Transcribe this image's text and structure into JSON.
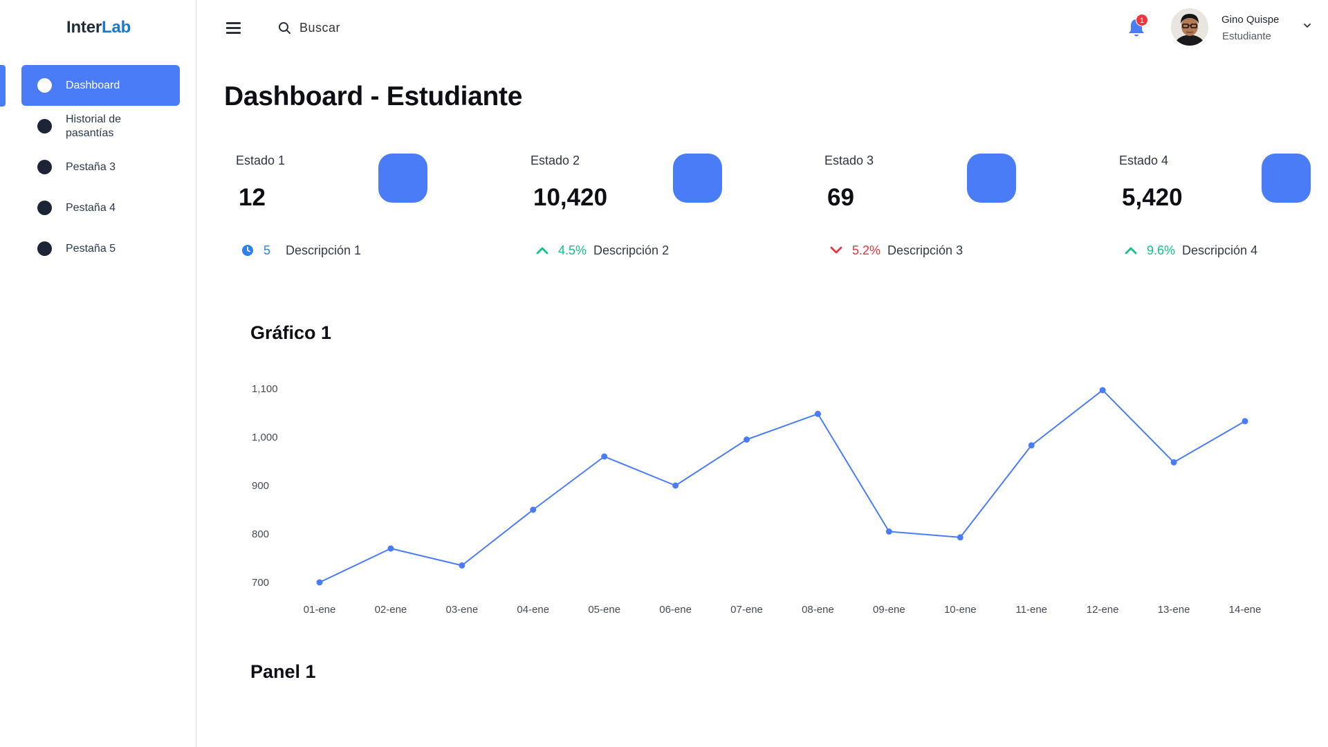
{
  "app": {
    "logo_part1": "Inter",
    "logo_part2": "Lab"
  },
  "sidebar": {
    "items": [
      {
        "label": "Dashboard",
        "active": true
      },
      {
        "label": "Historial de pasantías",
        "active": false
      },
      {
        "label": "Pestaña 3",
        "active": false
      },
      {
        "label": "Pestaña 4",
        "active": false
      },
      {
        "label": "Pestaña 5",
        "active": false
      }
    ]
  },
  "header": {
    "search_placeholder": "Buscar",
    "notification_count": "1",
    "user_name": "Gino Quispe",
    "user_role": "Estudiante"
  },
  "page": {
    "title": "Dashboard - Estudiante"
  },
  "stats": [
    {
      "label": "Estado 1",
      "value": "12",
      "indicator": "clock-icon",
      "delta": "5",
      "description": "Descripción 1",
      "color": "#2f80ed"
    },
    {
      "label": "Estado 2",
      "value": "10,420",
      "indicator": "arrow-up-icon",
      "delta": "4.5%",
      "description": "Descripción 2",
      "color": "#10c08a"
    },
    {
      "label": "Estado 3",
      "value": "69",
      "indicator": "arrow-down-icon",
      "delta": "5.2%",
      "description": "Descripción 3",
      "color": "#e8343c"
    },
    {
      "label": "Estado 4",
      "value": "5,420",
      "indicator": "arrow-up-icon",
      "delta": "9.6%",
      "description": "Descripción 4",
      "color": "#10c08a"
    }
  ],
  "chart_section": {
    "title": "Gráfico 1"
  },
  "panel_section": {
    "title": "Panel 1"
  },
  "colors": {
    "accent": "#4a7cf7",
    "positive": "#10c08a",
    "negative": "#e8343c",
    "info": "#2f80ed"
  },
  "chart_data": {
    "type": "line",
    "title": "Gráfico 1",
    "xlabel": "",
    "ylabel": "",
    "categories": [
      "01-ene",
      "02-ene",
      "03-ene",
      "04-ene",
      "05-ene",
      "06-ene",
      "07-ene",
      "08-ene",
      "09-ene",
      "10-ene",
      "11-ene",
      "12-ene",
      "13-ene",
      "14-ene"
    ],
    "series": [
      {
        "values": [
          700,
          770,
          735,
          850,
          960,
          900,
          995,
          1048,
          805,
          793,
          983,
          1097,
          948,
          1033
        ]
      }
    ],
    "yticks": [
      "700",
      "800",
      "900",
      "1,000",
      "1,100"
    ],
    "ylim": [
      700,
      1100
    ],
    "grid": false,
    "legend": "none",
    "color": "#4a7cf7"
  }
}
